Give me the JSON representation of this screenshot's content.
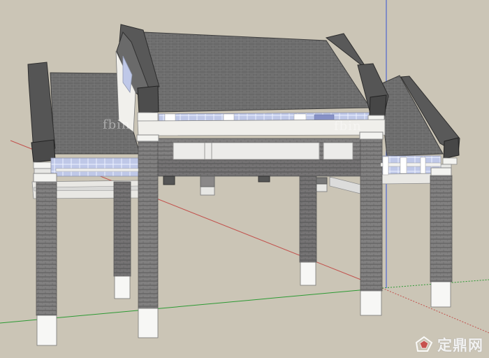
{
  "watermark": {
    "left_text": "fbin",
    "mid_text": "fbin",
    "brand_text": "定鼎网"
  },
  "colors": {
    "background": "#cbc5b6",
    "roof": "#6f6f6f",
    "roof_edge": "#474747",
    "brick": "#7d7b7b",
    "trim": "#f1f0ec",
    "axis_red": "#b33b35",
    "axis_green": "#2c9a33",
    "axis_blue": "#2847b9"
  }
}
